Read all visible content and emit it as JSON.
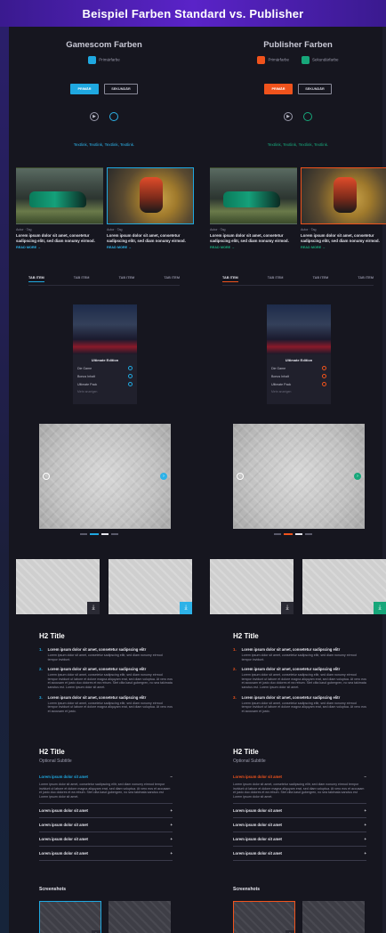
{
  "header": {
    "title": "Beispiel Farben Standard vs. Publisher"
  },
  "columns": [
    {
      "id": "gamescom",
      "section_title": "Gamescom Farben",
      "accent": "#1fa8e0",
      "secondary": "#2db2e8",
      "legend": [
        {
          "label": "Primärfarbe",
          "color": "#1fa8e0"
        }
      ],
      "buttons": {
        "primary": "PRIMÄR",
        "secondary": "SEKUNDÄR"
      },
      "taglinks": "Textlink, Textlink, Textlink, Textlink.",
      "cards": [
        {
          "meta": "Autor · Tag",
          "title": "Lorem ipsum dolor sit amet, consetetur sadipscing elitr, sed diam nonumy eirmod.",
          "more": "READ MORE →"
        },
        {
          "meta": "Autor · Tag",
          "title": "Lorem ipsum dolor sit amet, consetetur sadipscing elitr, sed diam nonumy eirmod.",
          "more": "READ MORE →"
        }
      ],
      "tabs": [
        "TAB ITEM",
        "TAB ITEM",
        "TAB ITEM",
        "TAB ITEM"
      ],
      "game": {
        "title": "Ultimate Edition",
        "rows": [
          "Die Game",
          "Bonus Inhalt",
          "Ultimate Pack"
        ],
        "more": "Mehr anzeigen"
      },
      "h2_title": "H2 Title",
      "list": [
        {
          "n": "1.",
          "title": "Lorem ipsum dolor sit amet, consetetur sadipscing elitr",
          "body": "Lorem ipsum dolor sit amet, consetetur sadipscing elitr, sed diam nonumy eirmod tempor invidunt."
        },
        {
          "n": "2.",
          "title": "Lorem ipsum dolor sit amet, consetetur sadipscing elitr",
          "body": "Lorem ipsum dolor sit amet, consetetur sadipscing elitr, sed diam nonumy eirmod tempor invidunt ut labore et dolore magna aliquyam erat, sed diam voluptua. At vero eos et accusam et justo duo dolores et ea rebum. Stet clita kasd gubergren, no sea takimata sanctus est. Lorem ipsum dolor sit amet."
        },
        {
          "n": "3.",
          "title": "Lorem ipsum dolor sit amet, consetetur sadipscing elitr",
          "body": "Lorem ipsum dolor sit amet, consetetur sadipscing elitr, sed diam nonumy eirmod tempor invidunt ut labore et dolore magna aliquyam erat, sed diam voluptua. At vero eos et accusam et justo."
        }
      ],
      "h2_title2": "H2 Title",
      "subtitle": "Optional Subtitle",
      "accordion": {
        "open_title": "Lorem ipsum dolor sit amet",
        "open_body": "Lorem ipsum dolor sit amet, consetetur sadipscing elitr, sed diam nonumy eirmod tempor invidunt ut labore et dolore magna aliquyam erat, sed diam voluptua. At vero eos et accusam et justo duo dolores et ea rebum. Stet clita kasd gubergren, no sea takimata sanctus est Lorem ipsum dolor sit amet.",
        "rows": [
          "Lorem ipsum dolor sit amet",
          "Lorem ipsum dolor sit amet",
          "Lorem ipsum dolor sit amet",
          "Lorem ipsum dolor sit amet"
        ]
      },
      "screenshots_title": "Screenshots"
    },
    {
      "id": "publisher",
      "section_title": "Publisher Farben",
      "accent": "#f0531c",
      "secondary": "#17a77a",
      "legend": [
        {
          "label": "Primärfarbe",
          "color": "#f0531c"
        },
        {
          "label": "Sekundärfarbe",
          "color": "#17a77a"
        }
      ],
      "buttons": {
        "primary": "PRIMÄR",
        "secondary": "SEKUNDÄR"
      },
      "taglinks": "Textlink, Textlink, Textlink, Textlink.",
      "cards": [
        {
          "meta": "Autor · Tag",
          "title": "Lorem ipsum dolor sit amet, consetetur sadipscing elitr, sed diam nonumy eirmod.",
          "more": "READ MORE →"
        },
        {
          "meta": "Autor · Tag",
          "title": "Lorem ipsum dolor sit amet, consetetur sadipscing elitr, sed diam nonumy eirmod.",
          "more": "READ MORE →"
        }
      ],
      "tabs": [
        "TAB ITEM",
        "TAB ITEM",
        "TAB ITEM",
        "TAB ITEM"
      ],
      "game": {
        "title": "Ultimate Edition",
        "rows": [
          "Die Game",
          "Bonus Inhalt",
          "Ultimate Pack"
        ],
        "more": "Mehr anzeigen"
      },
      "h2_title": "H2 Title",
      "list": [
        {
          "n": "1.",
          "title": "Lorem ipsum dolor sit amet, consetetur sadipscing elitr",
          "body": "Lorem ipsum dolor sit amet, consetetur sadipscing elitr, sed diam nonumy eirmod tempor invidunt."
        },
        {
          "n": "2.",
          "title": "Lorem ipsum dolor sit amet, consetetur sadipscing elitr",
          "body": "Lorem ipsum dolor sit amet, consetetur sadipscing elitr, sed diam nonumy eirmod tempor invidunt ut labore et dolore magna aliquyam erat, sed diam voluptua. At vero eos et accusam et justo duo dolores et ea rebum. Stet clita kasd gubergren, no sea takimata sanctus est. Lorem ipsum dolor sit amet."
        },
        {
          "n": "3.",
          "title": "Lorem ipsum dolor sit amet, consetetur sadipscing elitr",
          "body": "Lorem ipsum dolor sit amet, consetetur sadipscing elitr, sed diam nonumy eirmod tempor invidunt ut labore et dolore magna aliquyam erat, sed diam voluptua. At vero eos et accusam et justo."
        }
      ],
      "h2_title2": "H2 Title",
      "subtitle": "Optional Subtitle",
      "accordion": {
        "open_title": "Lorem ipsum dolor sit amet",
        "open_body": "Lorem ipsum dolor sit amet, consetetur sadipscing elitr, sed diam nonumy eirmod tempor invidunt ut labore et dolore magna aliquyam erat, sed diam voluptua. At vero eos et accusam et justo duo dolores et ea rebum. Stet clita kasd gubergren, no sea takimata sanctus est Lorem ipsum dolor sit amet.",
        "rows": [
          "Lorem ipsum dolor sit amet",
          "Lorem ipsum dolor sit amet",
          "Lorem ipsum dolor sit amet",
          "Lorem ipsum dolor sit amet"
        ]
      },
      "screenshots_title": "Screenshots"
    }
  ],
  "icons": {
    "arrow_left": "‹",
    "arrow_right": "›",
    "download": "⤓",
    "plus": "+",
    "minus": "−",
    "play": "▶"
  }
}
